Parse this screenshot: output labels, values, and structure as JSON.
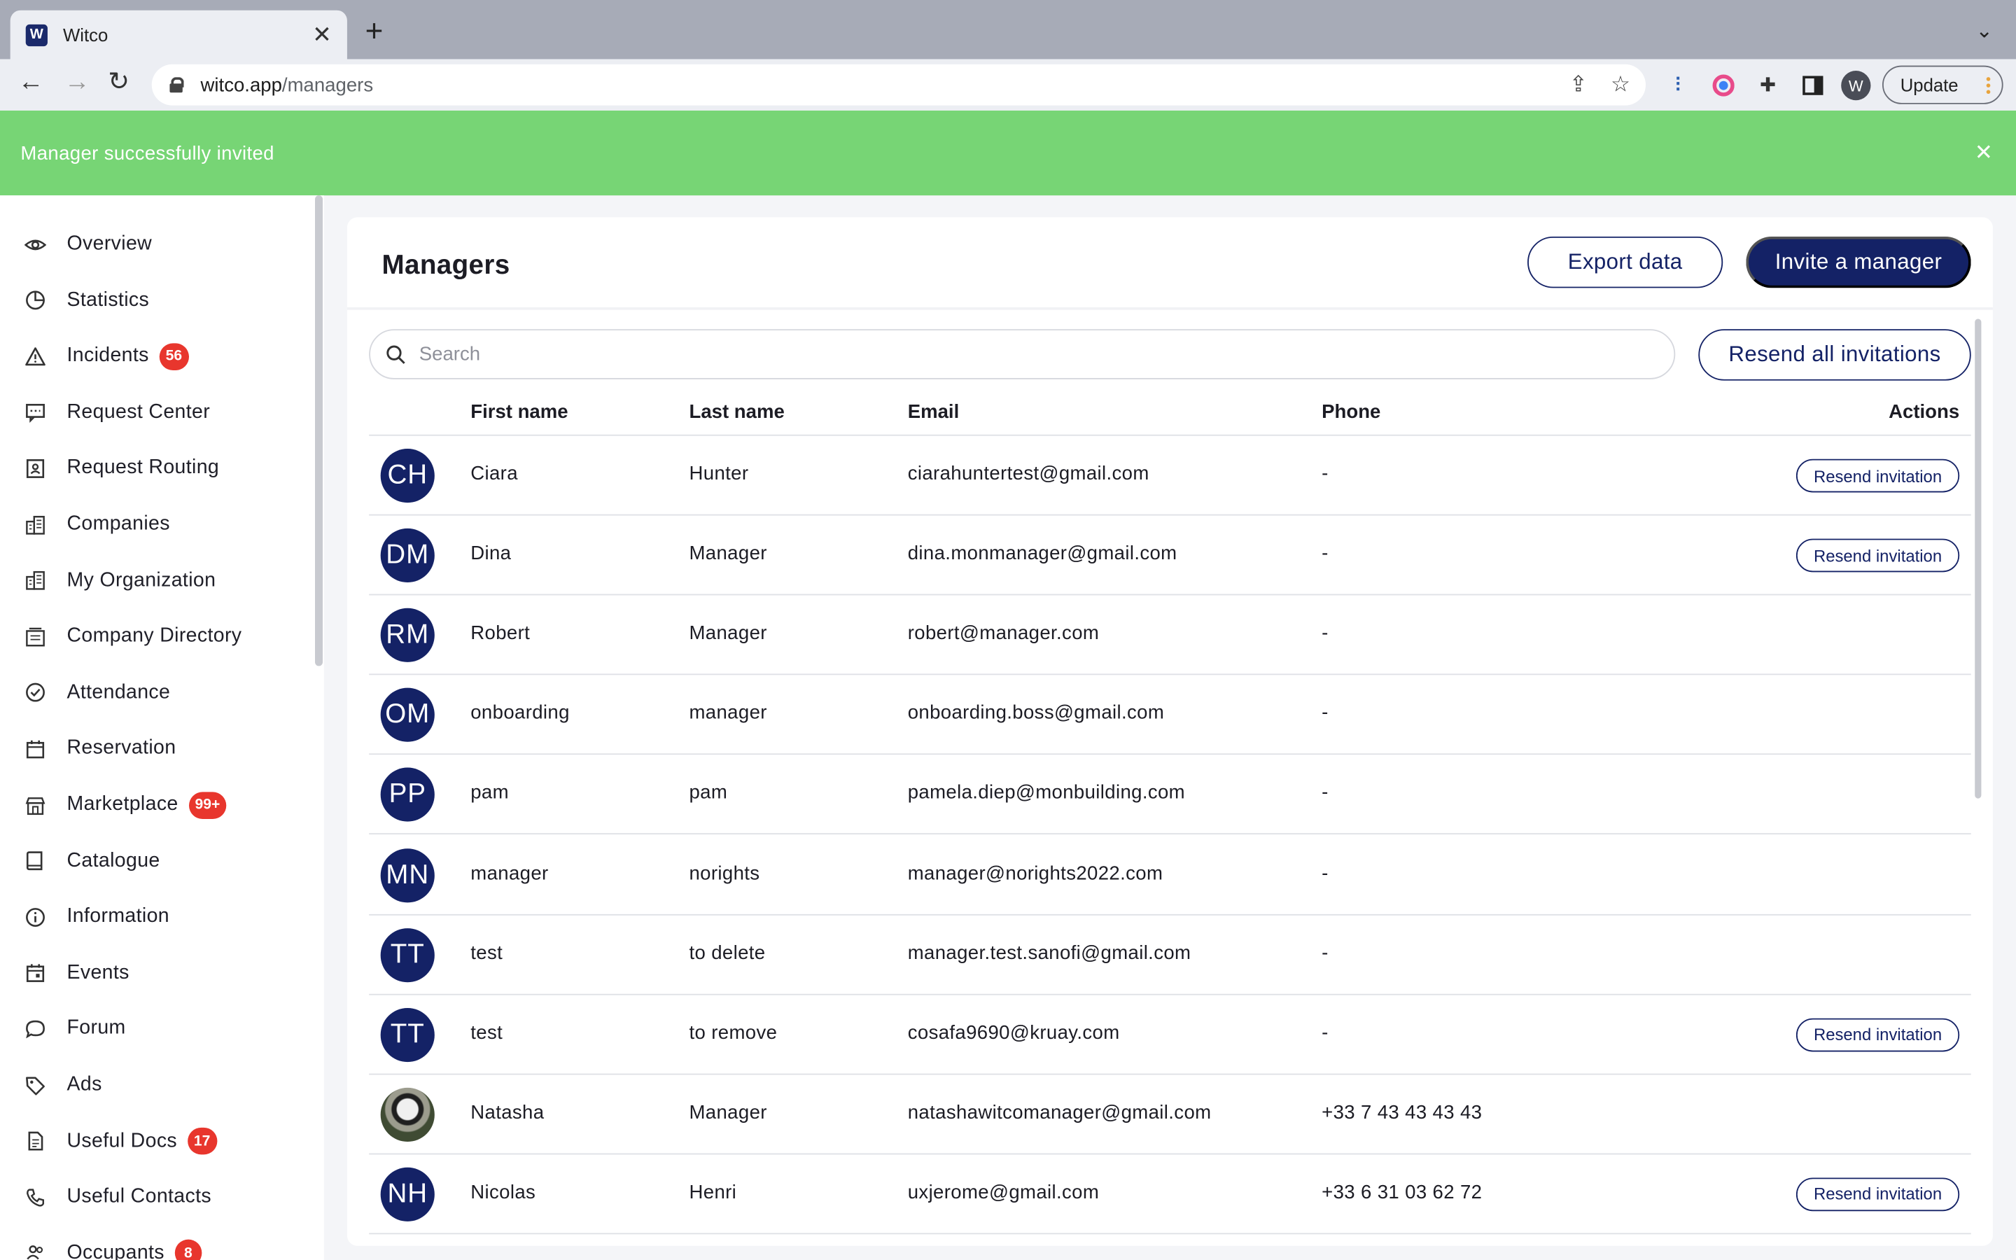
{
  "browser": {
    "tab_title": "Witco",
    "favicon_letter": "W",
    "url_host": "witco.app",
    "url_path": "/managers",
    "profile_initial": "W",
    "update_label": "Update"
  },
  "toast": {
    "message": "Manager successfully invited",
    "color": "#77d575"
  },
  "sidebar": {
    "items": [
      {
        "label": "Overview",
        "icon": "eye-icon"
      },
      {
        "label": "Statistics",
        "icon": "pie-chart-icon"
      },
      {
        "label": "Incidents",
        "icon": "warning-icon",
        "badge": "56"
      },
      {
        "label": "Request Center",
        "icon": "message-icon"
      },
      {
        "label": "Request Routing",
        "icon": "contact-card-icon"
      },
      {
        "label": "Companies",
        "icon": "building-icon"
      },
      {
        "label": "My Organization",
        "icon": "building-icon"
      },
      {
        "label": "Company Directory",
        "icon": "directory-icon"
      },
      {
        "label": "Attendance",
        "icon": "check-circle-icon"
      },
      {
        "label": "Reservation",
        "icon": "calendar-icon"
      },
      {
        "label": "Marketplace",
        "icon": "store-icon",
        "badge": "99+"
      },
      {
        "label": "Catalogue",
        "icon": "book-icon"
      },
      {
        "label": "Information",
        "icon": "info-icon"
      },
      {
        "label": "Events",
        "icon": "event-calendar-icon"
      },
      {
        "label": "Forum",
        "icon": "chat-bubble-icon"
      },
      {
        "label": "Ads",
        "icon": "tag-icon"
      },
      {
        "label": "Useful Docs",
        "icon": "document-icon",
        "badge": "17"
      },
      {
        "label": "Useful Contacts",
        "icon": "phone-icon"
      },
      {
        "label": "Occupants",
        "icon": "people-icon",
        "badge": "8"
      }
    ]
  },
  "main": {
    "title": "Managers",
    "export_label": "Export data",
    "invite_label": "Invite a manager",
    "search_placeholder": "Search",
    "resend_all_label": "Resend all invitations",
    "columns": {
      "first_name": "First name",
      "last_name": "Last name",
      "email": "Email",
      "phone": "Phone",
      "actions": "Actions"
    },
    "resend_label": "Resend invitation",
    "rows": [
      {
        "initials": "CH",
        "first": "Ciara",
        "last": "Hunter",
        "email": "ciarahuntertest@gmail.com",
        "phone": "-",
        "resend": true
      },
      {
        "initials": "DM",
        "first": "Dina",
        "last": "Manager",
        "email": "dina.monmanager@gmail.com",
        "phone": "-",
        "resend": true
      },
      {
        "initials": "RM",
        "first": "Robert",
        "last": "Manager",
        "email": "robert@manager.com",
        "phone": "-",
        "resend": false
      },
      {
        "initials": "OM",
        "first": "onboarding",
        "last": "manager",
        "email": "onboarding.boss@gmail.com",
        "phone": "-",
        "resend": false
      },
      {
        "initials": "PP",
        "first": "pam",
        "last": "pam",
        "email": "pamela.diep@monbuilding.com",
        "phone": "-",
        "resend": false
      },
      {
        "initials": "MN",
        "first": "manager",
        "last": "norights",
        "email": "manager@norights2022.com",
        "phone": "-",
        "resend": false
      },
      {
        "initials": "TT",
        "first": "test",
        "last": "to delete",
        "email": "manager.test.sanofi@gmail.com",
        "phone": "-",
        "resend": false
      },
      {
        "initials": "TT",
        "first": "test",
        "last": "to remove",
        "email": "cosafa9690@kruay.com",
        "phone": "-",
        "resend": true
      },
      {
        "initials": "",
        "photo": true,
        "first": "Natasha",
        "last": "Manager",
        "email": "natashawitcomanager@gmail.com",
        "phone": "+33 7 43 43 43 43",
        "resend": false
      },
      {
        "initials": "NH",
        "first": "Nicolas",
        "last": "Henri",
        "email": "uxjerome@gmail.com",
        "phone": "+33 6 31 03 62 72",
        "resend": true
      }
    ]
  },
  "colors": {
    "primary": "#142266",
    "badge": "#e8362d"
  }
}
